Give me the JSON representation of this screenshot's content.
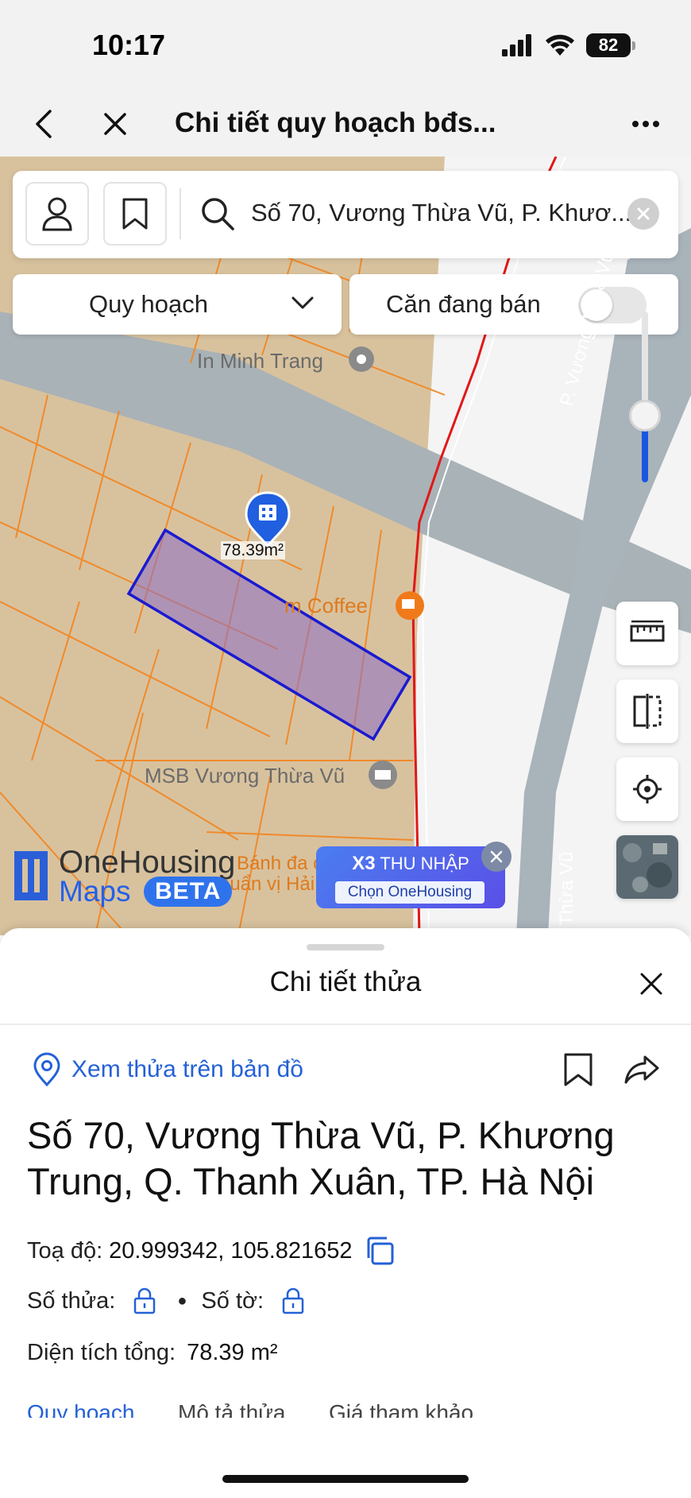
{
  "status_bar": {
    "time": "10:17",
    "battery": "82"
  },
  "nav": {
    "title": "Chi tiết quy hoạch bđs..."
  },
  "search": {
    "value": "Số 70, Vương Thừa Vũ, P. Khươ..."
  },
  "filters": {
    "planning_label": "Quy hoạch",
    "for_sale_label": "Căn đang bán",
    "for_sale_on": false
  },
  "map": {
    "labels": {
      "poi_top": "In Minh Trang",
      "poi_coffee": "m Coffee",
      "poi_bank": "MSB Vương Thừa Vũ",
      "poi_bottom_1": "Bánh đa c",
      "poi_bottom_2": "chuẩn vị Hải Phòng...",
      "street_right": "P. Vương Thừa Vũ",
      "street_bottom": "Thừa Vũ"
    },
    "parcel_area": "78.39m²",
    "zoom_level": 0.38,
    "logo": {
      "line1": "OneHousing",
      "line2": "Maps",
      "badge": "BETA"
    },
    "promo": {
      "highlight": "X3",
      "text": "THU NHẬP",
      "cta": "Chọn OneHousing"
    }
  },
  "sheet": {
    "title": "Chi tiết thửa",
    "view_on_map": "Xem thửa trên bản đồ",
    "address": "Số 70, Vương Thừa Vũ, P. Khương Trung, Q. Thanh Xuân, TP. Hà Nội",
    "coords_label": "Toạ độ:",
    "coords_value": "20.999342, 105.821652",
    "parcel_no_label": "Số thửa:",
    "sheet_no_label": "Số tờ:",
    "area_label": "Diện tích tổng:",
    "area_value": "78.39 m²",
    "tabs": [
      "Quy hoạch",
      "Mô tả thửa",
      "Giá tham khảo"
    ]
  },
  "colors": {
    "accent": "#2461d6",
    "parcel_border": "#1a1ad0",
    "road_red": "#e01818",
    "land": "#d9c3a0"
  }
}
